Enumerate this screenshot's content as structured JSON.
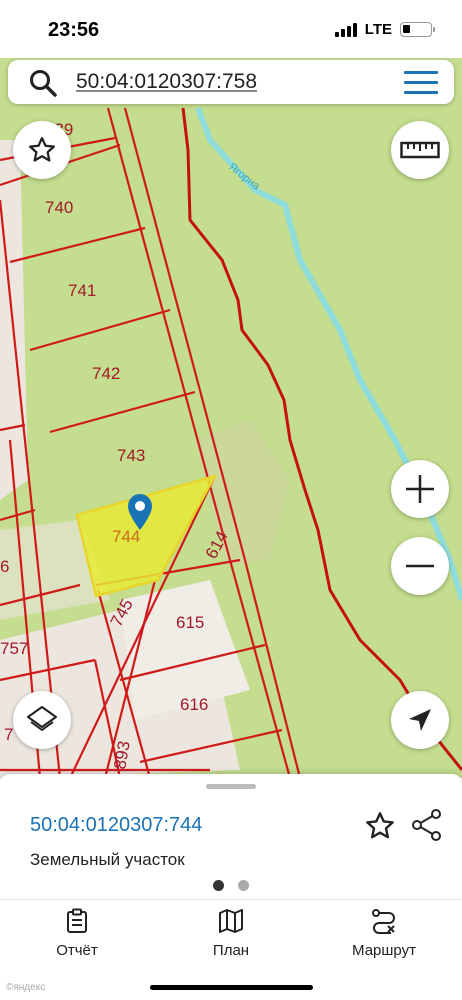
{
  "status_bar": {
    "time": "23:56",
    "network": "LTE",
    "battery_level": 0.25
  },
  "search": {
    "query": "50:04:0120307:758"
  },
  "map": {
    "colors": {
      "forest": "#c4dd8e",
      "urban": "#ece6df",
      "boundary": "#d01a1a",
      "river": "#8fdcdc",
      "selected": "#e6ea36",
      "pin": "#1a73b5"
    },
    "river_label": "Ягорна",
    "parcel_labels": [
      "739",
      "740",
      "741",
      "742",
      "743",
      "744",
      "614",
      "745",
      "615",
      "616",
      "757",
      "893",
      "6",
      "7"
    ]
  },
  "controls": {
    "favorite": "star-icon",
    "ruler": "ruler-icon",
    "zoom_in": "plus-icon",
    "zoom_out": "minus-icon",
    "layers": "layers-icon",
    "locate": "navigation-arrow-icon"
  },
  "sheet": {
    "parcel_id": "50:04:0120307:744",
    "parcel_type": "Земельный участок",
    "page_count": 2,
    "active_page": 1
  },
  "tabs": [
    {
      "label": "Отчёт",
      "icon": "report-icon"
    },
    {
      "label": "План",
      "icon": "map-icon"
    },
    {
      "label": "Маршрут",
      "icon": "route-icon"
    }
  ],
  "watermark": "©яндекс"
}
